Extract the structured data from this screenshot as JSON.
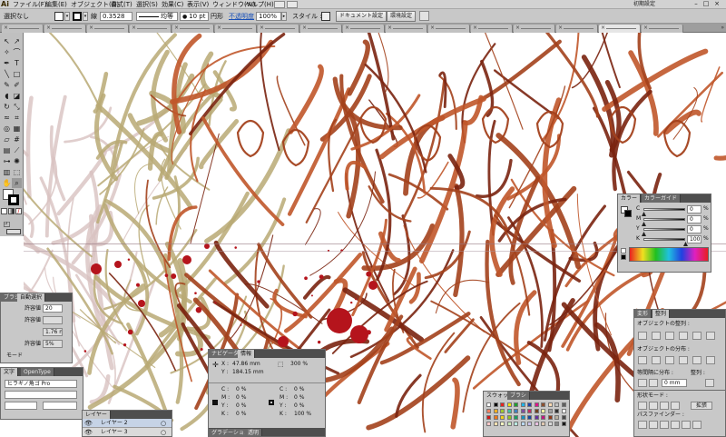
{
  "app": {
    "logo": "Ai"
  },
  "menubar": {
    "items": [
      "ファイル(F)",
      "編集(E)",
      "オブジェクト(O)",
      "書式(T)",
      "選択(S)",
      "効果(C)",
      "表示(V)",
      "ウィンドウ(W)",
      "ヘルプ(H)"
    ],
    "workspace_label": "初期設定"
  },
  "controlbar": {
    "selection": "選択なし",
    "stroke_weight": "0.3528",
    "stroke_style": "均等",
    "brush_size": "10 pt",
    "brush_shape": "円形",
    "opacity_label": "不透明度",
    "opacity_value": "100%",
    "style_label": "スタイル :",
    "doc_setup": "ドキュメント設定",
    "preferences": "環境設定"
  },
  "tabs": {
    "count": 16,
    "active_index": 14,
    "overflow": "»"
  },
  "info_panel": {
    "tabs": [
      "ナビゲーター",
      "情報"
    ],
    "x_label": "X :",
    "x_value": "47.86 mm",
    "y_label": "Y :",
    "y_value": "184.15 mm",
    "zoom": "300 %",
    "cmyk_left": [
      {
        "label": "C :",
        "value": "0 %"
      },
      {
        "label": "M :",
        "value": "0 %"
      },
      {
        "label": "Y :",
        "value": "0 %"
      },
      {
        "label": "K :",
        "value": "0 %"
      }
    ],
    "cmyk_right": [
      {
        "label": "C :",
        "value": "0 %"
      },
      {
        "label": "M :",
        "value": "0 %"
      },
      {
        "label": "Y :",
        "value": "0 %"
      },
      {
        "label": "K :",
        "value": "100 %"
      }
    ],
    "bottom_tabs": [
      "グラデーション",
      "透明"
    ]
  },
  "color_panel": {
    "tabs": [
      "カラー",
      "カラーガイド"
    ],
    "channels": [
      {
        "label": "C",
        "value": "0",
        "unit": "%",
        "level": 0
      },
      {
        "label": "M",
        "value": "0",
        "unit": "%",
        "level": 0
      },
      {
        "label": "Y",
        "value": "0",
        "unit": "%",
        "level": 0
      },
      {
        "label": "K",
        "value": "100",
        "unit": "%",
        "level": 1
      }
    ]
  },
  "align_panel": {
    "tabs": [
      "変形",
      "整列"
    ],
    "align_objects": "オブジェクトの整列 :",
    "distribute_objects": "オブジェクトの分布 :",
    "spacing_label": "等間隔に分布 :",
    "align_to_label": "整列 :",
    "spacing_value": "0 mm",
    "shape_mode": "形状モード :",
    "expand": "拡張",
    "pathfinder": "パスファインダー :"
  },
  "swatches_panel": {
    "tabs": [
      "スウォッチ",
      "ブラシ"
    ],
    "colors": [
      "#ffffff",
      "#000000",
      "#e8231f",
      "#f5e50a",
      "#20a030",
      "#1fb3e8",
      "#2040a8",
      "#e0148c",
      "#8c5030",
      "#fdd8b0",
      "#c0c0c0",
      "#606060",
      "#f08060",
      "#f8b020",
      "#a0c830",
      "#40c0a0",
      "#4080c0",
      "#8050a0",
      "#c03060",
      "#704020",
      "#f0f0a0",
      "#a0a0a0",
      "#303030",
      "#ffffff",
      "#d01818",
      "#f07818",
      "#f0d018",
      "#90c020",
      "#18a060",
      "#1890c0",
      "#1848a0",
      "#6830a0",
      "#c01880",
      "#903818",
      "#b8b0a0",
      "#484848",
      "#f8c8c8",
      "#f8e0b0",
      "#f8f8c0",
      "#c8e8b8",
      "#b8e8e0",
      "#b8d8f0",
      "#c8c0e8",
      "#e8c0e0",
      "#e0c8b0",
      "#d8d8d8",
      "#888888",
      "#181818"
    ]
  },
  "char_panel": {
    "tabs": [
      "文字",
      "OpenType"
    ],
    "font": "ヒラギノ角ゴ Pro"
  },
  "wrap_panel": {
    "tabs": [
      "ブラシ",
      "自動選択"
    ],
    "rows": [
      {
        "label": "許容値",
        "value": "20"
      },
      {
        "label": "許容値",
        "value": ""
      },
      {
        "label": "",
        "value": "1.76 m"
      },
      {
        "label": "許容値",
        "value": "5%"
      },
      {
        "label": "モード",
        "value": ""
      }
    ]
  },
  "layers_panel": {
    "tabs": [
      "レイヤー"
    ],
    "layers": [
      "レイヤー 2",
      "レイヤー 3"
    ]
  },
  "colors": {
    "menubar_bg": "#d2d2d2",
    "panel_bg": "#c8c8c8",
    "panel_header": "#4e4e4e",
    "ink_dark": "#7a2410",
    "ink_mid": "#a3411c",
    "ink_light": "#c0562a",
    "ink_tan": "#b9a974",
    "ink_pink": "#d8c2c0",
    "blood": "#b5141c"
  },
  "icons": [
    "selection-tool-icon",
    "direct-selection-icon",
    "pen-tool-icon",
    "type-tool-icon",
    "brush-tool-icon",
    "zoom-tool-icon",
    "eye-icon",
    "lock-icon"
  ]
}
